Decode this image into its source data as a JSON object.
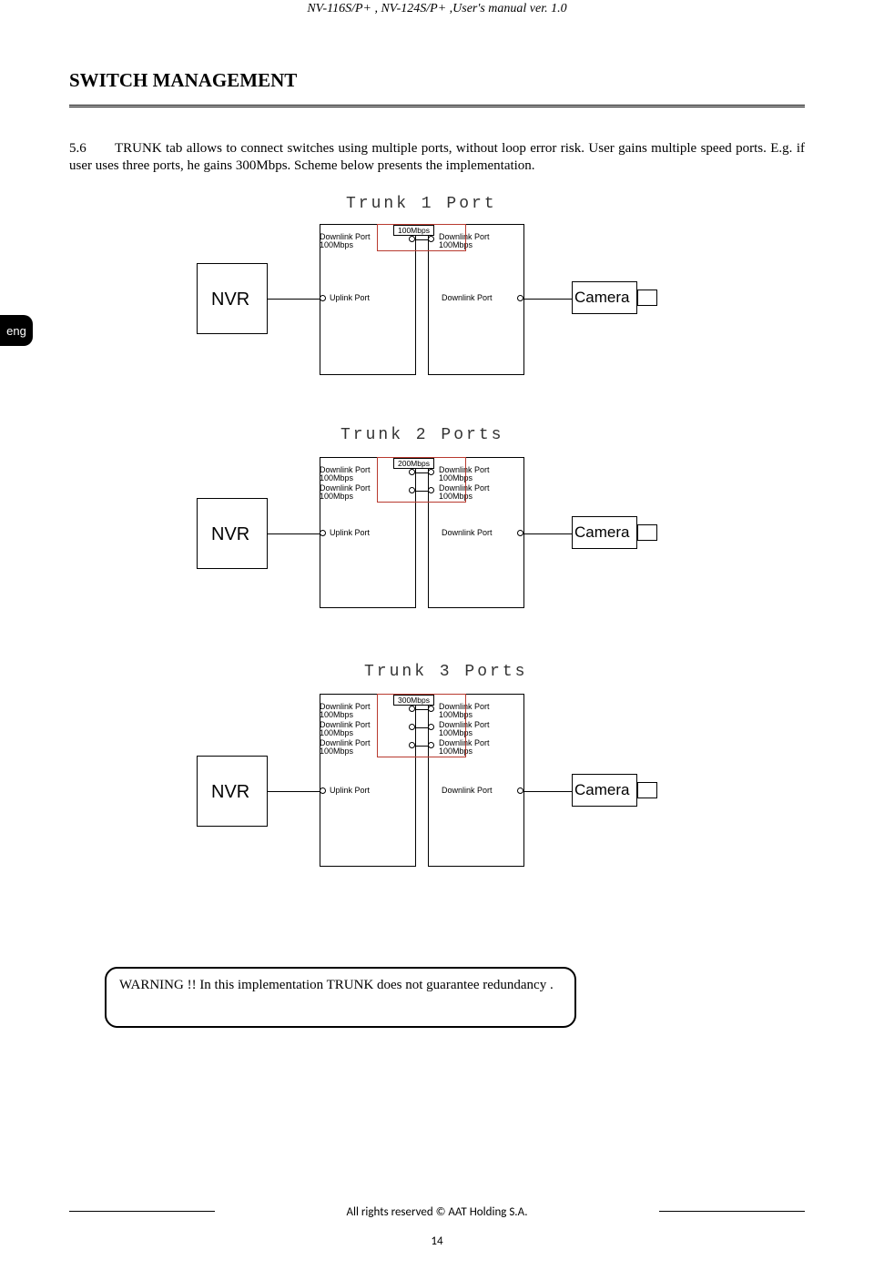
{
  "header": "NV-116S/P+ , NV-124S/P+ ,User's manual ver. 1.0",
  "section_title": "SWITCH  MANAGEMENT",
  "section_num": "5.6",
  "body": "TRUNK tab allows to connect switches using multiple ports, without loop error risk. User gains multiple speed ports. E.g. if user uses three ports, he gains 300Mbps. Scheme below presents the implementation.",
  "lang_tab": "eng",
  "diagrams": {
    "t1": {
      "title": "Trunk 1 Port",
      "nvr": "NVR",
      "camera": "Camera",
      "uplink": "Uplink Port",
      "downlink": "Downlink Port",
      "speed": "100Mbps",
      "left_ports": [
        "Downlink Port\n100Mbps"
      ],
      "right_ports": [
        "Downlink Port\n100Mbps"
      ]
    },
    "t2": {
      "title": "Trunk 2 Ports",
      "nvr": "NVR",
      "camera": "Camera",
      "uplink": "Uplink Port",
      "downlink": "Downlink Port",
      "speed": "200Mbps",
      "left_ports": [
        "Downlink Port\n100Mbps",
        "Downlink Port\n100Mbps"
      ],
      "right_ports": [
        "Downlink Port\n100Mbps",
        "Downlink Port\n100Mbps"
      ]
    },
    "t3": {
      "title": "Trunk 3 Ports",
      "nvr": "NVR",
      "camera": "Camera",
      "uplink": "Uplink Port",
      "downlink": "Downlink Port",
      "speed": "300Mbps",
      "left_ports": [
        "Downlink Port\n100Mbps",
        "Downlink Port\n100Mbps",
        "Downlink Port\n100Mbps"
      ],
      "right_ports": [
        "Downlink Port\n100Mbps",
        "Downlink Port\n100Mbps",
        "Downlink Port\n100Mbps"
      ]
    }
  },
  "warning": "WARNING !! In this implementation TRUNK does not guarantee redundancy .",
  "footer": "All rights reserved © AAT Holding S.A.",
  "page": "14"
}
